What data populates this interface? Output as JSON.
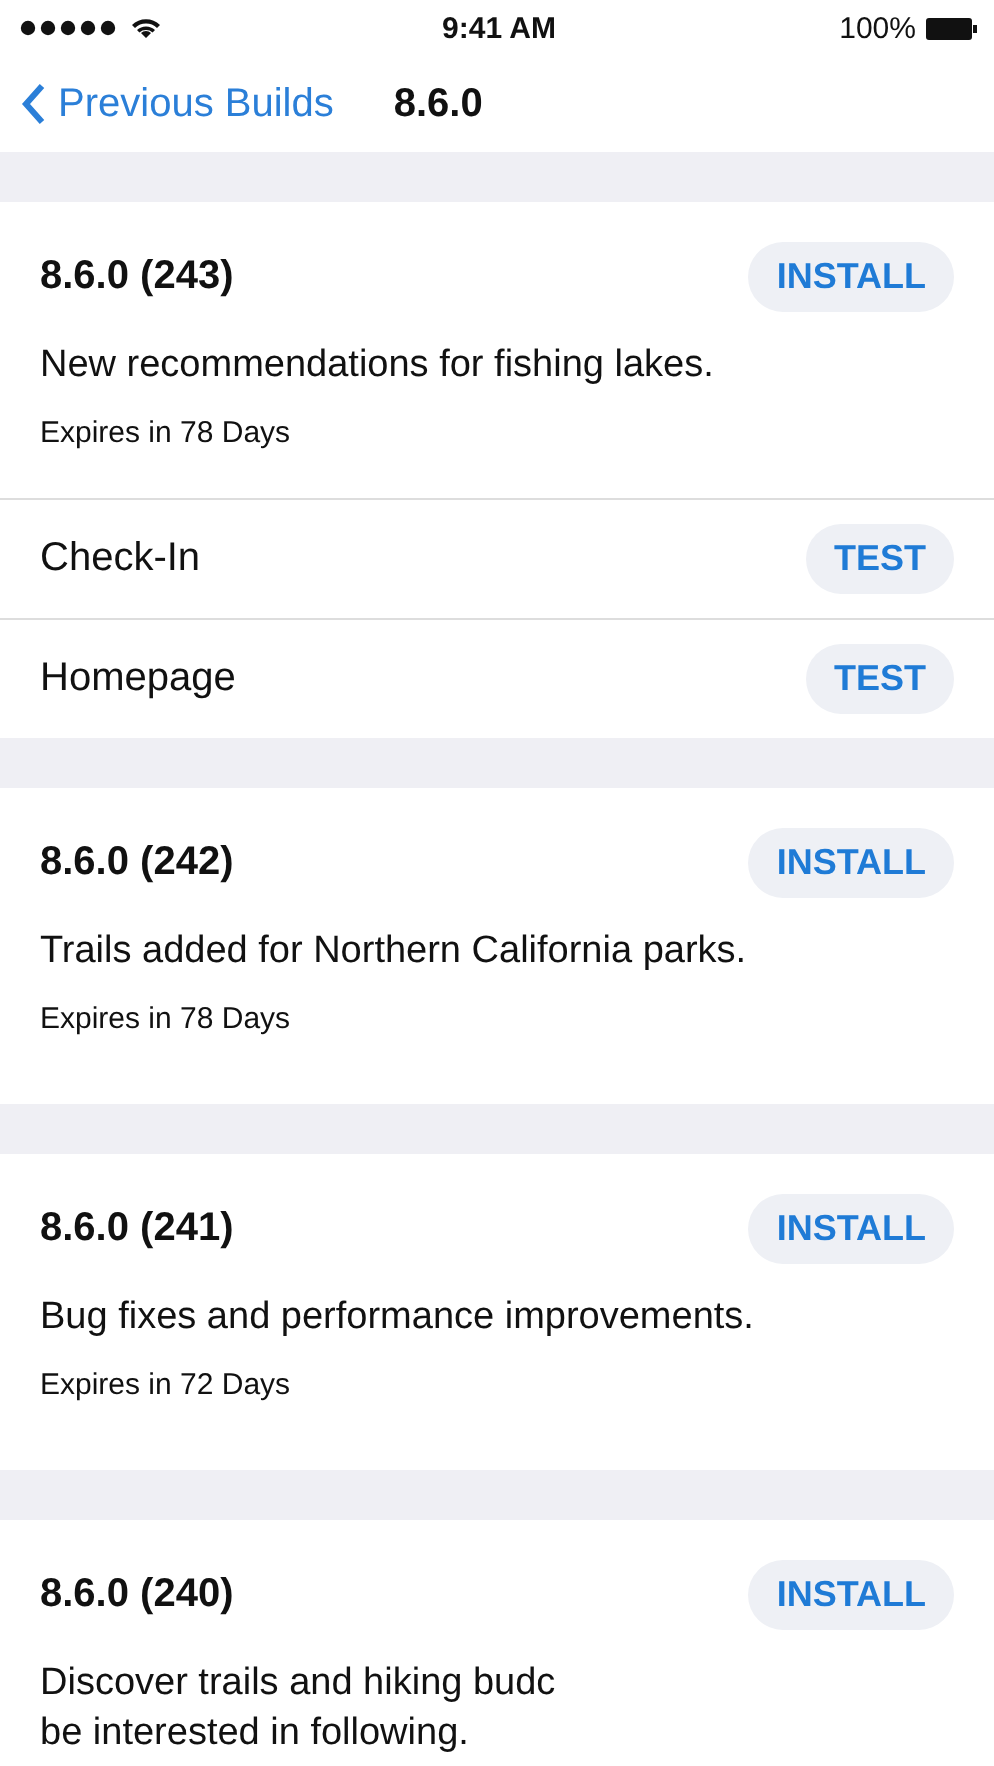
{
  "status_bar": {
    "time": "9:41 AM",
    "battery": "100%"
  },
  "nav": {
    "back": "Previous Builds",
    "title": "8.6.0"
  },
  "builds": [
    {
      "title": "8.6.0 (243)",
      "button": "INSTALL",
      "description": [
        "New recommendations for fishing lakes."
      ],
      "expires": "Expires in 78 Days",
      "groups": [
        {
          "name": "Check-In",
          "button": "TEST"
        },
        {
          "name": "Homepage",
          "button": "TEST"
        }
      ]
    },
    {
      "title": "8.6.0 (242)",
      "button": "INSTALL",
      "description": [
        "Trails added for Northern California parks."
      ],
      "expires": "Expires in 78 Days"
    },
    {
      "title": "8.6.0 (241)",
      "button": "INSTALL",
      "description": [
        "Bug fixes and performance improvements."
      ],
      "expires": "Expires in 72 Days"
    },
    {
      "title": "8.6.0 (240)",
      "button": "INSTALL",
      "description": [
        "Discover trails and hiking budc",
        "be interested in following."
      ]
    }
  ]
}
